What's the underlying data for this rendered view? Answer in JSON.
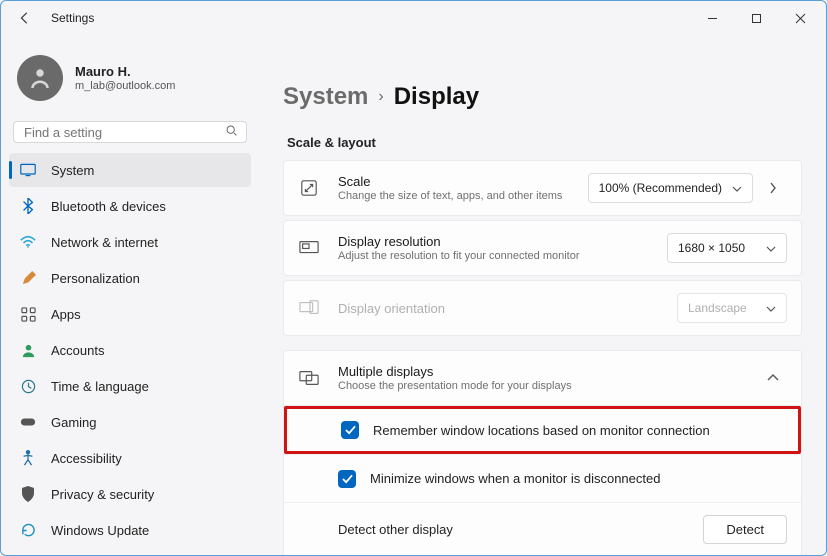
{
  "window": {
    "title": "Settings"
  },
  "profile": {
    "name": "Mauro H.",
    "email": "m_lab@outlook.com"
  },
  "search": {
    "placeholder": "Find a setting"
  },
  "nav": {
    "items": [
      {
        "label": "System",
        "active": true
      },
      {
        "label": "Bluetooth & devices"
      },
      {
        "label": "Network & internet"
      },
      {
        "label": "Personalization"
      },
      {
        "label": "Apps"
      },
      {
        "label": "Accounts"
      },
      {
        "label": "Time & language"
      },
      {
        "label": "Gaming"
      },
      {
        "label": "Accessibility"
      },
      {
        "label": "Privacy & security"
      },
      {
        "label": "Windows Update"
      }
    ]
  },
  "breadcrumb": {
    "parent": "System",
    "sep": "›",
    "current": "Display"
  },
  "section": {
    "title": "Scale & layout"
  },
  "scale": {
    "title": "Scale",
    "subtitle": "Change the size of text, apps, and other items",
    "value": "100% (Recommended)"
  },
  "resolution": {
    "title": "Display resolution",
    "subtitle": "Adjust the resolution to fit your connected monitor",
    "value": "1680 × 1050"
  },
  "orientation": {
    "title": "Display orientation",
    "value": "Landscape"
  },
  "multiple": {
    "title": "Multiple displays",
    "subtitle": "Choose the presentation mode for your displays",
    "remember": "Remember window locations based on monitor connection",
    "minimize": "Minimize windows when a monitor is disconnected",
    "detect_label": "Detect other display",
    "detect_button": "Detect"
  }
}
